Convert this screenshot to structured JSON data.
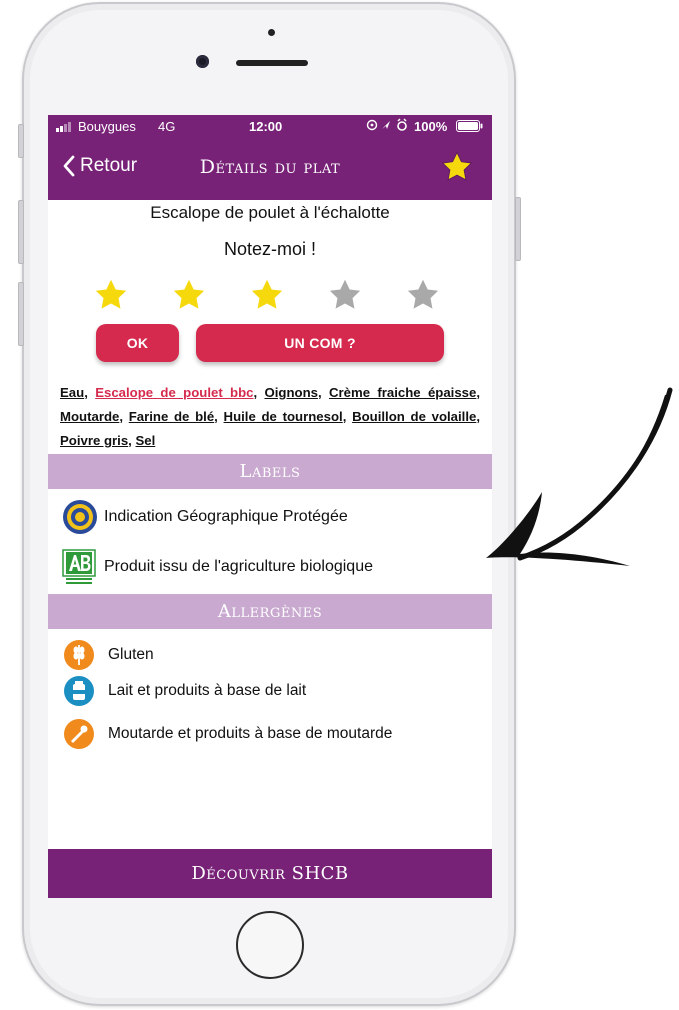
{
  "status_bar": {
    "carrier": "Bouygues",
    "network": "4G",
    "time": "12:00",
    "battery": "100%"
  },
  "nav": {
    "back_label": "Retour",
    "title": "Détails du plat",
    "icons": [
      "chevron-left-icon",
      "star-icon"
    ]
  },
  "dish": {
    "name": "Escalope de poulet à l'échalotte",
    "rate_prompt": "Notez-moi !",
    "rating": 3,
    "rating_max": 5
  },
  "buttons": {
    "ok": "OK",
    "comment": "UN COM ?"
  },
  "ingredients": [
    {
      "name": "Eau",
      "highlight": false
    },
    {
      "name": "Escalope de poulet bbc",
      "highlight": true
    },
    {
      "name": "Oignons",
      "highlight": false
    },
    {
      "name": "Crème fraiche épaisse",
      "highlight": false
    },
    {
      "name": "Moutarde",
      "highlight": false
    },
    {
      "name": "Farine de blé",
      "highlight": false
    },
    {
      "name": "Huile de tournesol",
      "highlight": false
    },
    {
      "name": "Bouillon de volaille",
      "highlight": false
    },
    {
      "name": "Poivre gris",
      "highlight": false
    },
    {
      "name": "Sel",
      "highlight": false
    }
  ],
  "labels_section": {
    "title": "Labels",
    "items": [
      {
        "text": "Indication Géographique Protégée",
        "icon": "igp-seal-icon"
      },
      {
        "text": "Produit issu de l'agriculture biologique",
        "icon": "ab-organic-icon"
      }
    ]
  },
  "allergens_section": {
    "title": "Allergènes",
    "items": [
      {
        "text": "Gluten",
        "icon": "wheat-icon"
      },
      {
        "text": "Lait et produits à base de lait",
        "icon": "milk-icon"
      },
      {
        "text": "Moutarde et produits à base de moutarde",
        "icon": "mustard-icon"
      }
    ]
  },
  "footer": {
    "label": "Découvrir SHCB"
  },
  "colors": {
    "brand_purple": "#772277",
    "section_lilac": "#c9a9cf",
    "accent_red": "#d52a4d",
    "star_on": "#f5d90c",
    "star_off": "#a9a9a9"
  }
}
